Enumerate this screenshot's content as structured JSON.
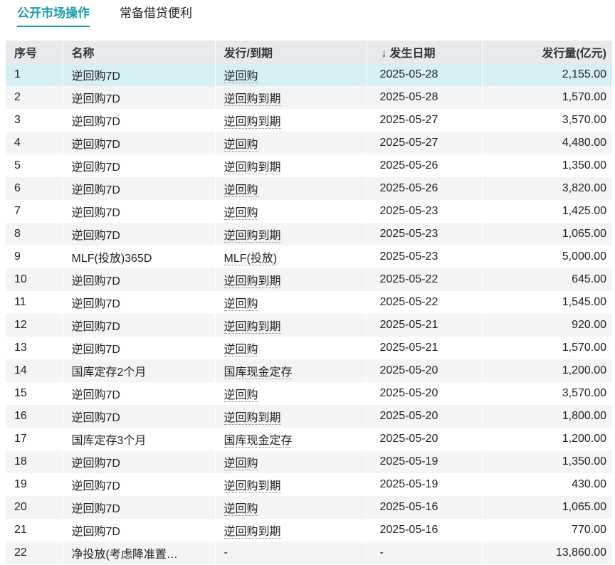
{
  "tabs": [
    {
      "label": "公开市场操作",
      "active": true
    },
    {
      "label": "常备借贷便利",
      "active": false
    }
  ],
  "table": {
    "headers": {
      "index": "序号",
      "name": "名称",
      "type": "发行/到期",
      "date": "发生日期",
      "amount": "发行量(亿元)"
    },
    "sort_indicator": "↓",
    "rows": [
      {
        "index": "1",
        "name": "逆回购7D",
        "type": "逆回购",
        "date": "2025-05-28",
        "amount": "2,155.00"
      },
      {
        "index": "2",
        "name": "逆回购7D",
        "type": "逆回购到期",
        "date": "2025-05-28",
        "amount": "1,570.00"
      },
      {
        "index": "3",
        "name": "逆回购7D",
        "type": "逆回购到期",
        "date": "2025-05-27",
        "amount": "3,570.00"
      },
      {
        "index": "4",
        "name": "逆回购7D",
        "type": "逆回购",
        "date": "2025-05-27",
        "amount": "4,480.00"
      },
      {
        "index": "5",
        "name": "逆回购7D",
        "type": "逆回购到期",
        "date": "2025-05-26",
        "amount": "1,350.00"
      },
      {
        "index": "6",
        "name": "逆回购7D",
        "type": "逆回购",
        "date": "2025-05-26",
        "amount": "3,820.00"
      },
      {
        "index": "7",
        "name": "逆回购7D",
        "type": "逆回购",
        "date": "2025-05-23",
        "amount": "1,425.00"
      },
      {
        "index": "8",
        "name": "逆回购7D",
        "type": "逆回购到期",
        "date": "2025-05-23",
        "amount": "1,065.00"
      },
      {
        "index": "9",
        "name": "MLF(投放)365D",
        "type": "MLF(投放)",
        "date": "2025-05-23",
        "amount": "5,000.00"
      },
      {
        "index": "10",
        "name": "逆回购7D",
        "type": "逆回购到期",
        "date": "2025-05-22",
        "amount": "645.00"
      },
      {
        "index": "11",
        "name": "逆回购7D",
        "type": "逆回购",
        "date": "2025-05-22",
        "amount": "1,545.00"
      },
      {
        "index": "12",
        "name": "逆回购7D",
        "type": "逆回购到期",
        "date": "2025-05-21",
        "amount": "920.00"
      },
      {
        "index": "13",
        "name": "逆回购7D",
        "type": "逆回购",
        "date": "2025-05-21",
        "amount": "1,570.00"
      },
      {
        "index": "14",
        "name": "国库定存2个月",
        "type": "国库现金定存",
        "date": "2025-05-20",
        "amount": "1,200.00"
      },
      {
        "index": "15",
        "name": "逆回购7D",
        "type": "逆回购",
        "date": "2025-05-20",
        "amount": "3,570.00"
      },
      {
        "index": "16",
        "name": "逆回购7D",
        "type": "逆回购到期",
        "date": "2025-05-20",
        "amount": "1,800.00"
      },
      {
        "index": "17",
        "name": "国库定存3个月",
        "type": "国库现金定存",
        "date": "2025-05-20",
        "amount": "1,200.00"
      },
      {
        "index": "18",
        "name": "逆回购7D",
        "type": "逆回购",
        "date": "2025-05-19",
        "amount": "1,350.00"
      },
      {
        "index": "19",
        "name": "逆回购7D",
        "type": "逆回购到期",
        "date": "2025-05-19",
        "amount": "430.00"
      },
      {
        "index": "20",
        "name": "逆回购7D",
        "type": "逆回购",
        "date": "2025-05-16",
        "amount": "1,065.00"
      },
      {
        "index": "21",
        "name": "逆回购7D",
        "type": "逆回购到期",
        "date": "2025-05-16",
        "amount": "770.00"
      },
      {
        "index": "22",
        "name": "净投放(考虑降准置…",
        "type": "-",
        "date": "-",
        "amount": "13,860.00"
      }
    ]
  },
  "colors": {
    "accent": "#1a9aa8",
    "header_bg": "#e7e9ec",
    "stripe_bg": "#f3f4f6",
    "selected_bg": "#d6eff5"
  }
}
